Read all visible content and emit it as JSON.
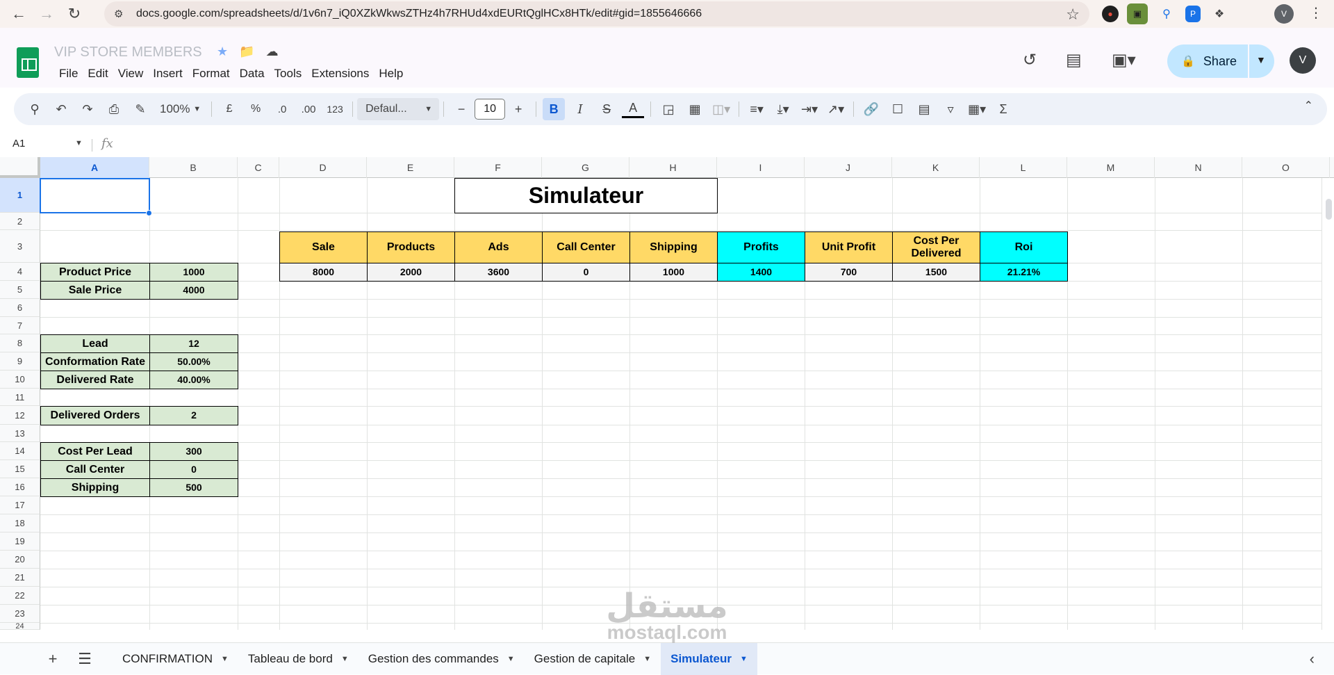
{
  "browser": {
    "url": "docs.google.com/spreadsheets/d/1v6n7_iQ0XZkWkwsZTHz4h7RHUd4xdEURtQglHCx8HTk/edit#gid=1855646666",
    "profile_initial": "V"
  },
  "app": {
    "doc_title": "VIP STORE MEMBERS",
    "menu": [
      "File",
      "Edit",
      "View",
      "Insert",
      "Format",
      "Data",
      "Tools",
      "Extensions",
      "Help"
    ],
    "share_label": "Share",
    "avatar_initial": "V"
  },
  "toolbar": {
    "zoom": "100%",
    "currency": "£",
    "percent": "%",
    "dec_decrease": ".0",
    "dec_increase": ".00",
    "number_format": "123",
    "font": "Defaul...",
    "font_size": "10",
    "bold": "B",
    "italic": "I",
    "strike": "S",
    "text_color": "A"
  },
  "formula_bar": {
    "cell_ref": "A1",
    "fx": "fx"
  },
  "grid": {
    "columns": [
      "A",
      "B",
      "C",
      "D",
      "E",
      "F",
      "G",
      "H",
      "I",
      "J",
      "K",
      "L",
      "M",
      "N",
      "O"
    ],
    "rows": [
      "1",
      "2",
      "3",
      "4",
      "5",
      "6",
      "7",
      "8",
      "9",
      "10",
      "11",
      "12",
      "13",
      "14",
      "15",
      "16",
      "17",
      "18",
      "19",
      "20",
      "21",
      "22",
      "23",
      "24"
    ],
    "selected_cell": "A1"
  },
  "simulator": {
    "title": "Simulateur",
    "inputs": {
      "product_price": {
        "label": "Product Price",
        "value": "1000"
      },
      "sale_price": {
        "label": "Sale Price",
        "value": "4000"
      },
      "lead": {
        "label": "Lead",
        "value": "12"
      },
      "conformation_rate": {
        "label": "Conformation Rate",
        "value": "50.00%"
      },
      "delivered_rate": {
        "label": "Delivered Rate",
        "value": "40.00%"
      },
      "delivered_orders": {
        "label": "Delivered Orders",
        "value": "2"
      },
      "cost_per_lead": {
        "label": "Cost Per Lead",
        "value": "300"
      },
      "call_center": {
        "label": "Call Center",
        "value": "0"
      },
      "shipping": {
        "label": "Shipping",
        "value": "500"
      }
    },
    "results": {
      "sale": {
        "label": "Sale",
        "value": "8000"
      },
      "products": {
        "label": "Products",
        "value": "2000"
      },
      "ads": {
        "label": "Ads",
        "value": "3600"
      },
      "call_center": {
        "label": "Call Center",
        "value": "0"
      },
      "shipping": {
        "label": "Shipping",
        "value": "1000"
      },
      "profits": {
        "label": "Profits",
        "value": "1400"
      },
      "unit_profit": {
        "label": "Unit Profit",
        "value": "700"
      },
      "cost_per_delivered": {
        "label": "Cost Per Delivered",
        "value": "1500"
      },
      "roi": {
        "label": "Roi",
        "value": "21.21%"
      }
    }
  },
  "sheets": {
    "tabs": [
      "CONFIRMATION",
      "Tableau de bord",
      "Gestion des commandes",
      "Gestion de capitale",
      "Simulateur"
    ],
    "active": "Simulateur"
  },
  "watermark": {
    "arabic": "مستقل",
    "latin": "mostaql.com"
  },
  "colors": {
    "label_green": "#d9ead3",
    "header_yellow": "#ffd966",
    "header_cyan": "#00ffff",
    "accent_blue": "#1a73e8"
  }
}
